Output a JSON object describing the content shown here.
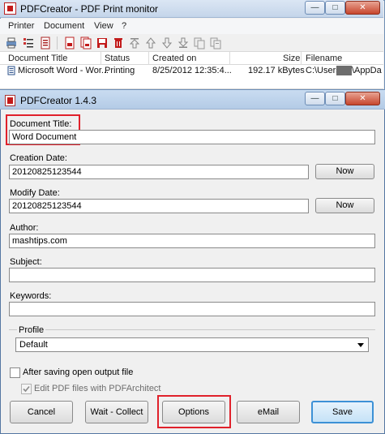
{
  "monitor": {
    "title": "PDFCreator - PDF Print monitor",
    "menu": [
      "Printer",
      "Document",
      "View",
      "?"
    ],
    "columns": [
      "Document Title",
      "Status",
      "Created on",
      "Size",
      "Filename"
    ],
    "row": {
      "title": "Microsoft Word - Wor...",
      "status": "Printing",
      "created": "8/25/2012 12:35:4...",
      "size": "192.17 kBytes",
      "filename_prefix": "C:\\Users\\",
      "filename_suffix": "\\AppDa"
    }
  },
  "dialog": {
    "title": "PDFCreator 1.4.3",
    "document_title": {
      "label": "Document Title:",
      "value": "Word Document"
    },
    "creation_date": {
      "label": "Creation Date:",
      "value": "20120825123544",
      "now": "Now"
    },
    "modify_date": {
      "label": "Modify Date:",
      "value": "20120825123544",
      "now": "Now"
    },
    "author": {
      "label": "Author:",
      "value": "mashtips.com"
    },
    "subject": {
      "label": "Subject:",
      "value": ""
    },
    "keywords": {
      "label": "Keywords:",
      "value": ""
    },
    "profile": {
      "label": "Profile",
      "selected": "Default"
    },
    "after_saving": "After saving open output file",
    "edit_pdf": "Edit PDF files with PDFArchitect",
    "buttons": {
      "cancel": "Cancel",
      "wait": "Wait - Collect",
      "options": "Options",
      "email": "eMail",
      "save": "Save"
    }
  },
  "colors": {
    "highlight": "#e0212b",
    "primary_border": "#3d91d6"
  }
}
